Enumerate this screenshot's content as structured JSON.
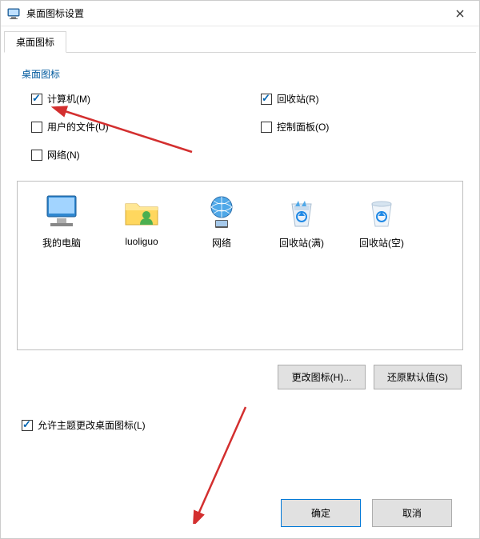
{
  "title": "桌面图标设置",
  "tab": "桌面图标",
  "group_label": "桌面图标",
  "checkboxes": {
    "computer": {
      "label": "计算机(M)",
      "checked": true
    },
    "recycle": {
      "label": "回收站(R)",
      "checked": true
    },
    "userfiles": {
      "label": "用户的文件(U)",
      "checked": false
    },
    "controlpanel": {
      "label": "控制面板(O)",
      "checked": false
    },
    "network": {
      "label": "网络(N)",
      "checked": false
    }
  },
  "icons": {
    "pc": "我的电脑",
    "user": "luoliguo",
    "net": "网络",
    "rbfull": "回收站(满)",
    "rbempty": "回收站(空)"
  },
  "buttons": {
    "change_icon": "更改图标(H)...",
    "restore": "还原默认值(S)",
    "ok": "确定",
    "cancel": "取消"
  },
  "allow_themes": {
    "label": "允许主题更改桌面图标(L)",
    "checked": true
  }
}
